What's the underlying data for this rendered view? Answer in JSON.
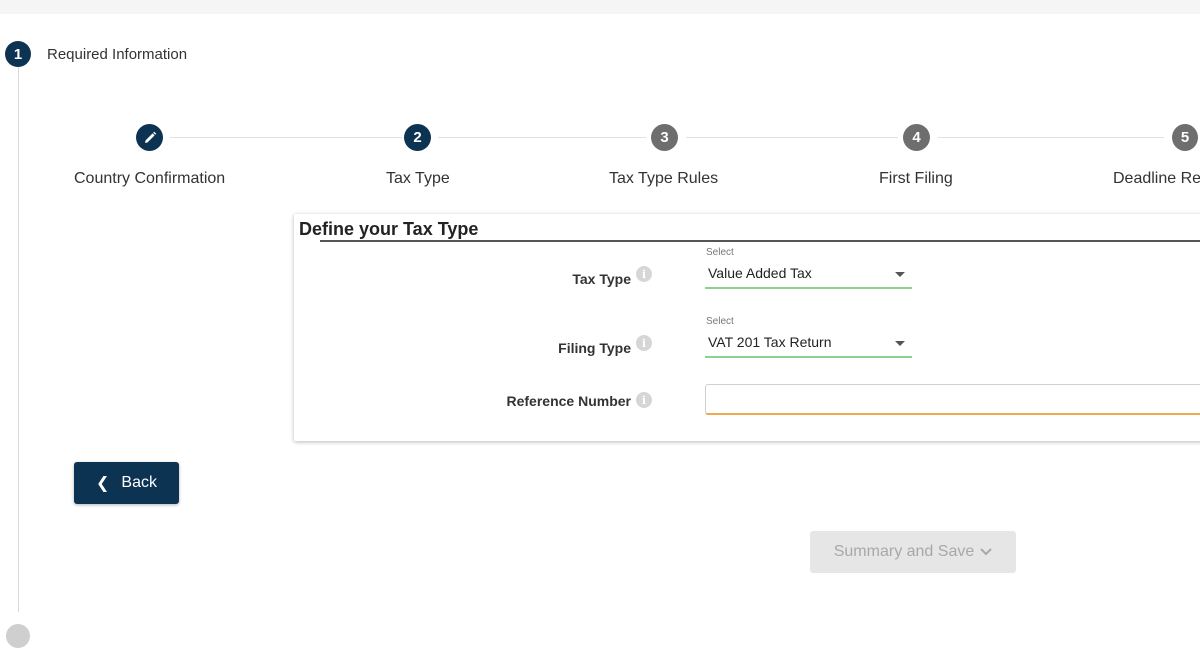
{
  "section": {
    "number": "1",
    "title": "Required Information"
  },
  "stepper": {
    "steps": [
      {
        "index": "",
        "icon": "pencil-icon",
        "label": "Country Confirmation",
        "state": "completed"
      },
      {
        "index": "2",
        "label": "Tax Type",
        "state": "active"
      },
      {
        "index": "3",
        "label": "Tax Type Rules",
        "state": "inactive"
      },
      {
        "index": "4",
        "label": "First Filing",
        "state": "inactive"
      },
      {
        "index": "5",
        "label": "Deadline Re",
        "state": "inactive"
      }
    ]
  },
  "form": {
    "title": "Define your Tax Type",
    "tax_type": {
      "label": "Tax Type",
      "caption": "Select",
      "value": "Value Added Tax"
    },
    "filing_type": {
      "label": "Filing Type",
      "caption": "Select",
      "value": "VAT 201 Tax Return"
    },
    "reference_number": {
      "label": "Reference Number",
      "value": ""
    },
    "info_glyph": "i"
  },
  "buttons": {
    "back": "Back",
    "summary": "Summary and Save"
  },
  "colors": {
    "primary": "#0d3353",
    "inactive_step": "#6e6e6e",
    "valid_underline": "#8fcf8f",
    "required_underline": "#f2a94e",
    "disabled_button": "#e6e6e6"
  }
}
